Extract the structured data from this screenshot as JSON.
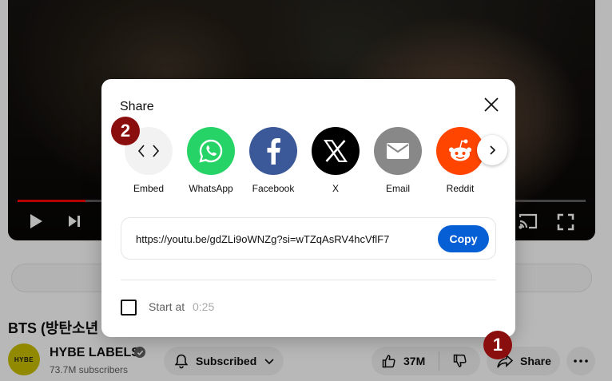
{
  "video": {
    "title": "BTS (방탄소년",
    "progress_fraction": 0.12
  },
  "channel": {
    "avatar_text": "HYBE",
    "name": "HYBE LABELS",
    "subscribers": "73.7M subscribers"
  },
  "actions": {
    "subscribed_label": "Subscribed",
    "likes_count": "37M",
    "share_label": "Share"
  },
  "dialog": {
    "title": "Share",
    "targets": [
      {
        "label": "Embed",
        "icon": "embed-code-icon",
        "color": "#f2f2f2"
      },
      {
        "label": "WhatsApp",
        "icon": "whatsapp-icon",
        "color": "#25d366"
      },
      {
        "label": "Facebook",
        "icon": "facebook-icon",
        "color": "#3b5998"
      },
      {
        "label": "X",
        "icon": "x-icon",
        "color": "#000000"
      },
      {
        "label": "Email",
        "icon": "email-icon",
        "color": "#888888"
      },
      {
        "label": "Reddit",
        "icon": "reddit-icon",
        "color": "#ff4500"
      }
    ],
    "url": "https://youtu.be/gdZLi9oWNZg?si=wTZqAsRV4hcVflF7",
    "copy_label": "Copy",
    "start_at_label": "Start at",
    "start_at_time": "0:25",
    "start_at_checked": false
  },
  "markers": {
    "step1": "1",
    "step2": "2",
    "color": "#8b0e0e"
  },
  "colors": {
    "copy_button": "#065fd4",
    "progress": "#ff0000"
  }
}
